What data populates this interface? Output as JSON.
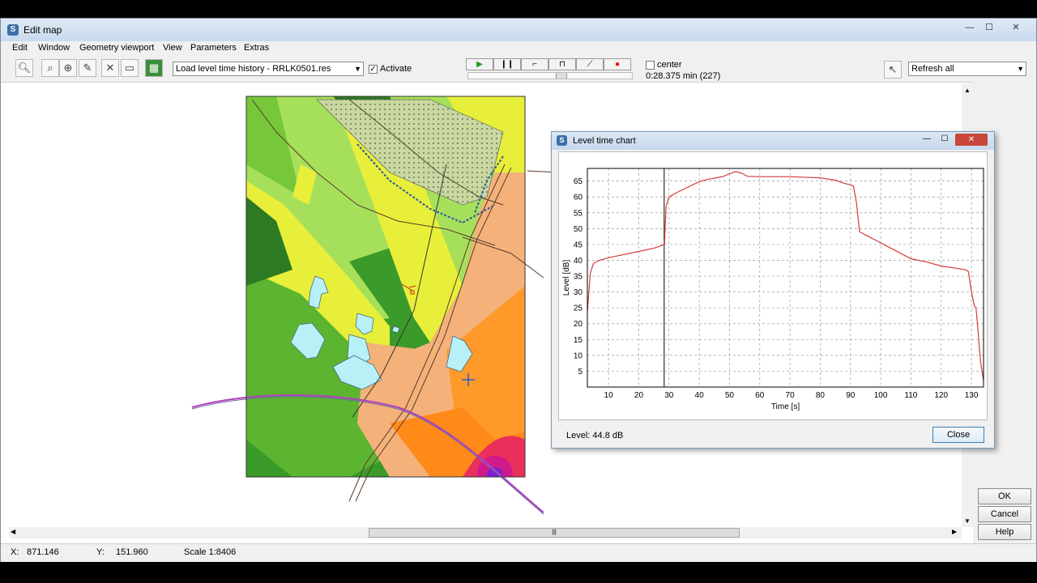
{
  "window": {
    "title": "Edit map",
    "controls": {
      "minimize": "—",
      "maximize": "☐",
      "close": "✕"
    }
  },
  "menu": [
    "Edit",
    "Window",
    "Geometry viewport",
    "View",
    "Parameters",
    "Extras"
  ],
  "toolbar": {
    "tools": [
      "zoom-in-icon",
      "zoom-window-icon",
      "zoom-plus-icon",
      "measure-icon",
      "select-cross-icon",
      "rectangle-icon",
      "level-map-icon"
    ],
    "load_combo": "Load level time history - RRLK0501.res",
    "activate_label": "Activate",
    "activate_checked": true,
    "center_label": "center",
    "center_checked": false,
    "time_readout": "0:28.375 min (227)",
    "refresh_combo": "Refresh all"
  },
  "statusbar": {
    "x_label": "X:",
    "x_value": "871.146",
    "y_label": "Y:",
    "y_value": "151.960",
    "scale": "Scale 1:8406"
  },
  "buttons": {
    "ok": "OK",
    "cancel": "Cancel",
    "help": "Help"
  },
  "chart_window": {
    "title": "Level time chart",
    "level_readout": "Level: 44.8 dB",
    "close_label": "Close"
  },
  "chart_data": {
    "type": "line",
    "xlabel": "Time [s]",
    "ylabel": "Level [dB]",
    "xlim": [
      3,
      134
    ],
    "ylim": [
      0,
      69
    ],
    "xticks": [
      10,
      20,
      30,
      40,
      50,
      60,
      70,
      80,
      90,
      100,
      110,
      120,
      130
    ],
    "yticks": [
      5,
      10,
      15,
      20,
      25,
      30,
      35,
      40,
      45,
      50,
      55,
      60,
      65
    ],
    "grid": true,
    "cursor_x": 28.4,
    "series": [
      {
        "color": "#d23a3a",
        "x": [
          3,
          4,
          5,
          7,
          10,
          15,
          20,
          25,
          28.5,
          29,
          30,
          33,
          36,
          40,
          43,
          45,
          48,
          50,
          52,
          54,
          56,
          60,
          70,
          80,
          85,
          88,
          90,
          91,
          92,
          93,
          95,
          100,
          105,
          110,
          115,
          120,
          125,
          128,
          129,
          130,
          131,
          131.5,
          132,
          133,
          134
        ],
        "y": [
          24,
          36,
          39,
          40,
          40.8,
          41.8,
          42.8,
          43.8,
          45,
          57,
          60,
          61.6,
          63,
          64.8,
          65.6,
          65.9,
          66.5,
          67.3,
          68,
          67.5,
          66.5,
          66.4,
          66.4,
          66,
          65.3,
          64.3,
          63.8,
          63.4,
          58,
          49,
          48,
          45.5,
          43,
          40.5,
          39.5,
          38.2,
          37.5,
          37,
          36.5,
          30,
          25.5,
          25,
          20,
          8,
          2
        ]
      }
    ]
  }
}
